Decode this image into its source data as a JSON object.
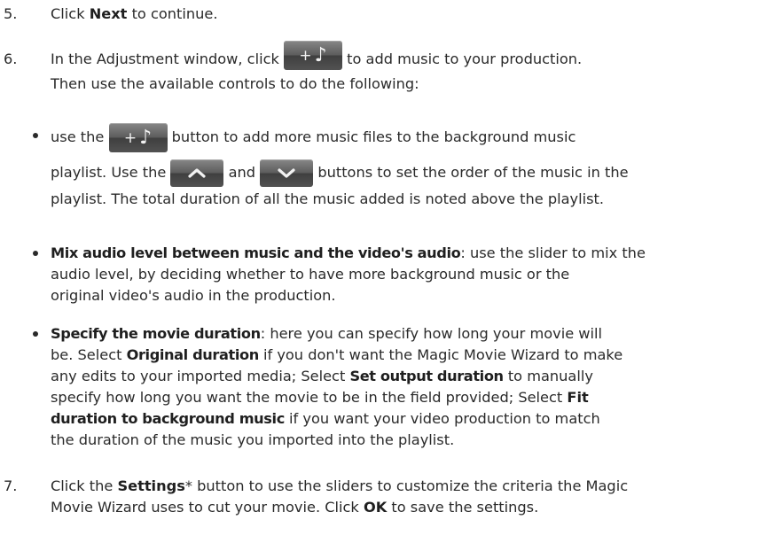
{
  "steps": [
    {
      "number": "5.",
      "parts": [
        "Click ",
        "Next",
        " to continue."
      ]
    },
    {
      "number": "6.",
      "line1_before": "In the Adjustment window, click ",
      "line1_after": " to add music to your production.",
      "line2": "Then use the available controls to do the following:"
    },
    {
      "number": "7.",
      "line1": [
        "Click the ",
        "Settings",
        "* button to use the sliders to customize the criteria the Magic"
      ],
      "line2": [
        "Movie Wizard uses to cut your movie. Click ",
        "OK",
        " to save the settings."
      ]
    }
  ],
  "bullets": [
    {
      "line1_before": "use the ",
      "line1_after": " button to add more music files to the background music",
      "line2_before": "playlist. Use the ",
      "line2_mid": " and ",
      "line2_after": " buttons to set the order of the music in the",
      "line3": "playlist. The total duration of all the music added is noted above the playlist."
    },
    {
      "bold": "Mix audio level between music and the video's audio",
      "line1_after": ": use the slider to mix the",
      "line2": "audio level, by deciding whether to have more background music or the",
      "line3": "original video's audio in the production."
    },
    {
      "bold": "Specify the movie duration",
      "line1_after": ": here you can specify how long your movie will",
      "line2_before": "be. Select ",
      "line2_bold": "Original duration",
      "line2_after": " if you don't want the Magic Movie Wizard to make",
      "line3_before": "any edits to your imported media; Select ",
      "line3_bold": "Set output duration",
      "line3_after": " to manually",
      "line4_before": "specify how long you want the movie to be in the field provided; Select ",
      "line4_bold": "Fit",
      "line5_bold": "duration to background music",
      "line5_after": " if you want your video production to match",
      "line6": "the duration of the music you imported into the playlist."
    }
  ],
  "icons": {
    "add_music": "+♪",
    "move_up": "chevron-up-icon",
    "move_down": "chevron-down-icon"
  }
}
